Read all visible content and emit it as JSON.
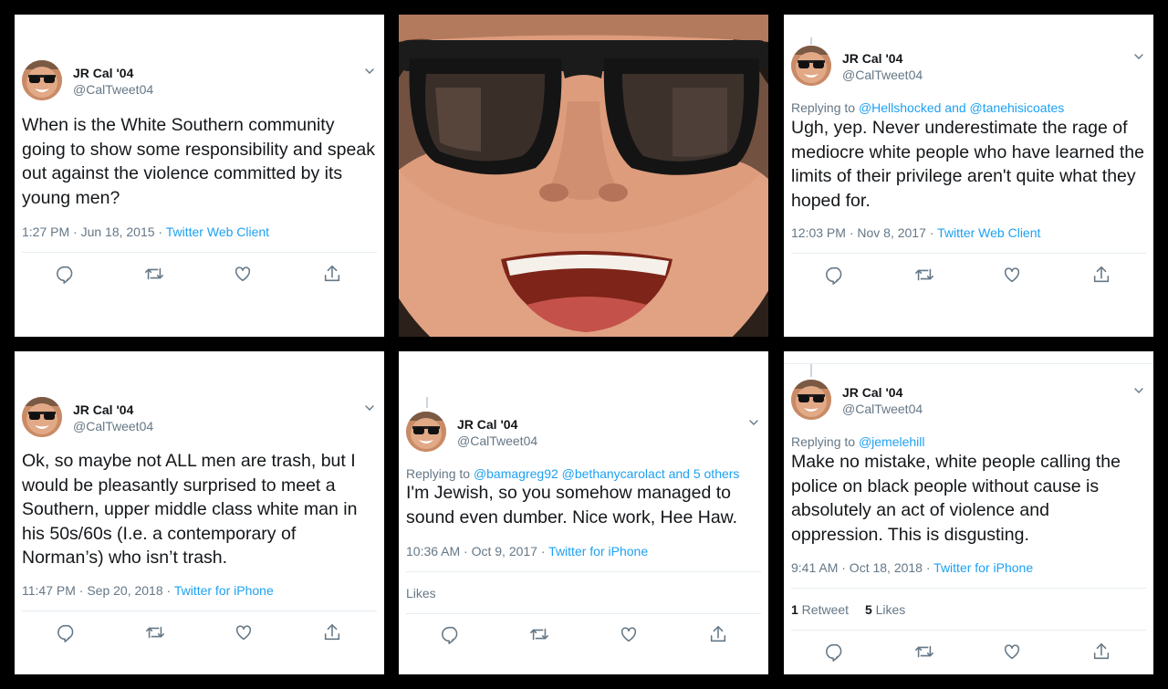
{
  "tweets": [
    {
      "name": "JR Cal '04",
      "handle": "@CalTweet04",
      "text": "When is the White Southern community going to show some responsibility and speak out against the violence committed by its young men?",
      "time": "1:27 PM · Jun 18, 2015 · ",
      "client": "Twitter Web Client"
    },
    {
      "name": "JR Cal '04",
      "handle": "@CalTweet04",
      "reply_prefix": "Replying to ",
      "reply_targets": "@Hellshocked and @tanehisicoates",
      "text": "Ugh, yep. Never underestimate the rage of mediocre white people who have learned the limits of their privilege aren't quite what they hoped for.",
      "time": "12:03 PM · Nov 8, 2017 · ",
      "client": "Twitter Web Client"
    },
    {
      "name": "JR Cal '04",
      "handle": "@CalTweet04",
      "text": "Ok, so maybe not ALL men are trash, but I would be pleasantly surprised to meet a Southern, upper middle class white man in his 50s/60s (I.e. a contemporary of Norman’s) who isn’t trash.",
      "time": "11:47 PM · Sep 20, 2018 · ",
      "client": "Twitter for iPhone"
    },
    {
      "name": "JR Cal '04",
      "handle": "@CalTweet04",
      "reply_prefix": "Replying to ",
      "reply_targets": "@bamagreg92 @bethanycarolact and 5 others",
      "text": "I'm Jewish, so you somehow managed to sound even dumber. Nice work, Hee Haw.",
      "time": "10:36 AM · Oct 9, 2017 · ",
      "client": "Twitter for iPhone",
      "likes_label": "Likes"
    },
    {
      "name": "JR Cal '04",
      "handle": "@CalTweet04",
      "reply_prefix": "Replying to ",
      "reply_targets": "@jemelehill",
      "text": "Make no mistake, white people calling the police on black people without cause is absolutely an act of violence and oppression. This is disgusting.",
      "time": "9:41 AM · Oct 18, 2018 · ",
      "client": "Twitter for iPhone",
      "retweets_count": "1",
      "retweets_label": " Retweet",
      "likes_count": "5",
      "likes_label": " Likes"
    }
  ],
  "icons": [
    "reply-icon",
    "retweet-icon",
    "like-icon",
    "share-icon",
    "chevron-down-icon"
  ],
  "colors": {
    "link": "#1da1f2",
    "muted": "#657786",
    "text": "#14171a",
    "background": "#000000"
  }
}
